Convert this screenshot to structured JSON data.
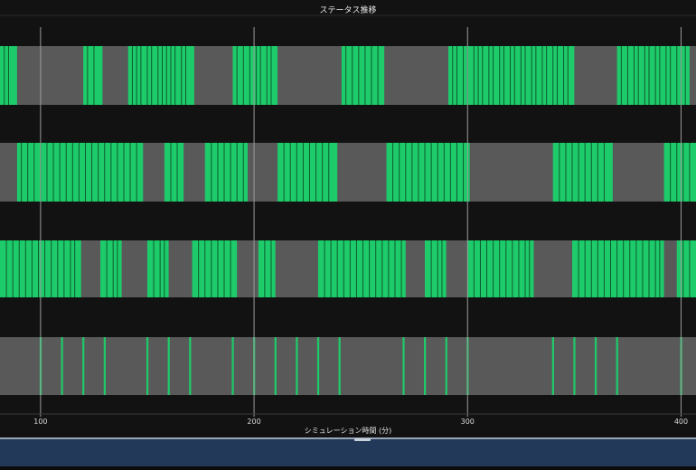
{
  "chart_data": {
    "type": "timeline",
    "title": "ステータス推移",
    "xlabel": "シミュレーション時間 (分)",
    "ylabel": "",
    "xlim": [
      81,
      407
    ],
    "x_ticks": [
      100,
      200,
      300,
      400
    ],
    "grid": true,
    "legend": "none",
    "colors": {
      "active": "#1ecb6a",
      "idle": "#595959",
      "background": "#121212",
      "band_gap": "#1a1a1a",
      "grid": "#9a9a9a",
      "divider": "#0e5a2e"
    },
    "lanes": [
      {
        "segments": [
          [
            81,
            89
          ],
          [
            120,
            129
          ],
          [
            141,
            172
          ],
          [
            190,
            211
          ],
          [
            241,
            261
          ],
          [
            291,
            350
          ],
          [
            370,
            404
          ]
        ],
        "dividers": [
          83,
          85,
          122,
          125,
          143,
          145,
          147,
          150,
          152,
          155,
          157,
          159,
          161,
          163,
          166,
          168,
          192,
          195,
          198,
          201,
          203,
          206,
          208,
          243,
          246,
          249,
          252,
          255,
          258,
          293,
          295,
          298,
          300,
          303,
          305,
          307,
          310,
          312,
          315,
          317,
          320,
          322,
          325,
          327,
          330,
          332,
          335,
          337,
          340,
          342,
          345,
          347,
          372,
          375,
          378,
          380,
          383,
          385,
          388,
          390,
          393,
          395,
          398,
          400,
          402
        ]
      },
      {
        "segments": [
          [
            89,
            148
          ],
          [
            158,
            167
          ],
          [
            177,
            197
          ],
          [
            211,
            239
          ],
          [
            262,
            301
          ],
          [
            340,
            368
          ],
          [
            392,
            407
          ]
        ],
        "dividers": [
          91,
          94,
          97,
          100,
          103,
          106,
          109,
          112,
          115,
          118,
          121,
          124,
          127,
          130,
          133,
          136,
          139,
          142,
          145,
          161,
          164,
          180,
          183,
          186,
          189,
          192,
          195,
          214,
          217,
          220,
          223,
          226,
          229,
          232,
          235,
          265,
          268,
          271,
          274,
          277,
          280,
          283,
          286,
          289,
          292,
          295,
          298,
          343,
          346,
          349,
          352,
          355,
          358,
          361,
          364,
          395,
          398,
          401,
          404
        ]
      },
      {
        "segments": [
          [
            81,
            119
          ],
          [
            128,
            138
          ],
          [
            150,
            160
          ],
          [
            171,
            192
          ],
          [
            202,
            210
          ],
          [
            230,
            271
          ],
          [
            280,
            290
          ],
          [
            300,
            331
          ],
          [
            349,
            392
          ],
          [
            398,
            407
          ]
        ],
        "dividers": [
          84,
          87,
          90,
          93,
          96,
          99,
          102,
          105,
          108,
          111,
          114,
          116,
          131,
          134,
          136,
          153,
          156,
          158,
          174,
          177,
          180,
          183,
          186,
          189,
          205,
          208,
          233,
          236,
          239,
          242,
          245,
          248,
          251,
          254,
          257,
          260,
          263,
          266,
          269,
          283,
          286,
          288,
          303,
          306,
          309,
          312,
          315,
          318,
          321,
          324,
          327,
          329,
          352,
          355,
          358,
          361,
          364,
          367,
          370,
          373,
          376,
          379,
          382,
          385,
          388,
          390,
          401,
          404
        ]
      },
      {
        "segments": [],
        "dividers": [],
        "pulses": [
          100,
          110,
          120,
          130,
          150,
          160,
          170,
          190,
          200,
          210,
          220,
          230,
          240,
          270,
          280,
          290,
          300,
          340,
          350,
          360,
          370,
          400
        ]
      }
    ]
  }
}
